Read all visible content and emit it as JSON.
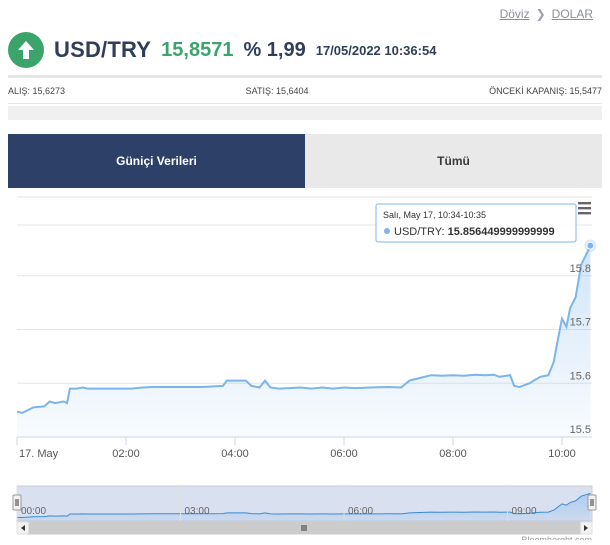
{
  "breadcrumb": {
    "items": [
      "Döviz",
      "DOLAR"
    ]
  },
  "quote": {
    "pair": "USD/TRY",
    "price": "15,8571",
    "change_percent": "% 1,99",
    "timestamp": "17/05/2022 10:36:54",
    "direction": "up",
    "icon": "arrow-up-icon",
    "accent_color": "#3aa46b"
  },
  "stats": {
    "bid": "ALIŞ: 15,6273",
    "ask": "SATIŞ: 15,6404",
    "prev_close": "ÖNCEKİ KAPANIŞ: 15,5477"
  },
  "tabs": [
    {
      "label": "Güniçi Verileri",
      "active": true
    },
    {
      "label": "Tümü",
      "active": false
    }
  ],
  "chart_data": {
    "type": "area",
    "series": [
      {
        "name": "USD/TRY",
        "color": "#7cb5ec",
        "points": [
          [
            0,
            15.547
          ],
          [
            0.1,
            15.545
          ],
          [
            0.2,
            15.55
          ],
          [
            0.3,
            15.555
          ],
          [
            0.5,
            15.557
          ],
          [
            0.6,
            15.566
          ],
          [
            0.7,
            15.563
          ],
          [
            0.85,
            15.566
          ],
          [
            0.92,
            15.563
          ],
          [
            0.97,
            15.59
          ],
          [
            1.1,
            15.59
          ],
          [
            1.2,
            15.592
          ],
          [
            1.3,
            15.59
          ],
          [
            1.5,
            15.59
          ],
          [
            1.7,
            15.59
          ],
          [
            1.9,
            15.59
          ],
          [
            2.1,
            15.59
          ],
          [
            2.3,
            15.592
          ],
          [
            2.5,
            15.593
          ],
          [
            2.8,
            15.593
          ],
          [
            3.1,
            15.593
          ],
          [
            3.4,
            15.593
          ],
          [
            3.78,
            15.595
          ],
          [
            3.85,
            15.605
          ],
          [
            4.2,
            15.605
          ],
          [
            4.3,
            15.595
          ],
          [
            4.45,
            15.592
          ],
          [
            4.55,
            15.605
          ],
          [
            4.65,
            15.592
          ],
          [
            4.8,
            15.59
          ],
          [
            5.0,
            15.591
          ],
          [
            5.2,
            15.592
          ],
          [
            5.4,
            15.59
          ],
          [
            5.6,
            15.592
          ],
          [
            5.8,
            15.59
          ],
          [
            6.0,
            15.592
          ],
          [
            6.2,
            15.591
          ],
          [
            6.5,
            15.592
          ],
          [
            6.8,
            15.593
          ],
          [
            7.05,
            15.592
          ],
          [
            7.2,
            15.605
          ],
          [
            7.4,
            15.61
          ],
          [
            7.6,
            15.615
          ],
          [
            7.8,
            15.614
          ],
          [
            8.0,
            15.615
          ],
          [
            8.2,
            15.614
          ],
          [
            8.4,
            15.616
          ],
          [
            8.6,
            15.615
          ],
          [
            8.75,
            15.616
          ],
          [
            8.85,
            15.612
          ],
          [
            9.05,
            15.615
          ],
          [
            9.12,
            15.595
          ],
          [
            9.22,
            15.593
          ],
          [
            9.4,
            15.6
          ],
          [
            9.6,
            15.612
          ],
          [
            9.75,
            15.615
          ],
          [
            9.85,
            15.64
          ],
          [
            9.92,
            15.68
          ],
          [
            10.0,
            15.72
          ],
          [
            10.08,
            15.705
          ],
          [
            10.15,
            15.74
          ],
          [
            10.25,
            15.76
          ],
          [
            10.35,
            15.82
          ],
          [
            10.52,
            15.856
          ]
        ]
      }
    ],
    "x_ticks": [
      {
        "value": 0,
        "label": "17. May"
      },
      {
        "value": 2,
        "label": "02:00"
      },
      {
        "value": 4,
        "label": "04:00"
      },
      {
        "value": 6,
        "label": "06:00"
      },
      {
        "value": 8,
        "label": "08:00"
      },
      {
        "value": 10,
        "label": "10:00"
      }
    ],
    "y_ticks": [
      15.5,
      15.6,
      15.7,
      15.8
    ],
    "y_tick_labels": [
      "15.5",
      "15.6",
      "15.7",
      "15.8"
    ],
    "ylim": [
      15.5,
      15.9
    ],
    "xlim": [
      0,
      10.55
    ],
    "grid": true,
    "tooltip": {
      "header": "Salı, May 17, 10:34-10:35",
      "series": "USD/TRY:",
      "value": "15.856449999999999"
    },
    "navigator": {
      "ticks": [
        {
          "value": 0,
          "label": "00:00"
        },
        {
          "value": 3,
          "label": "03:00"
        },
        {
          "value": 6,
          "label": "06:00"
        },
        {
          "value": 9,
          "label": "09:00"
        }
      ]
    },
    "menu_icon": "hamburger-menu-icon",
    "credits": "Bloomberght.com"
  }
}
